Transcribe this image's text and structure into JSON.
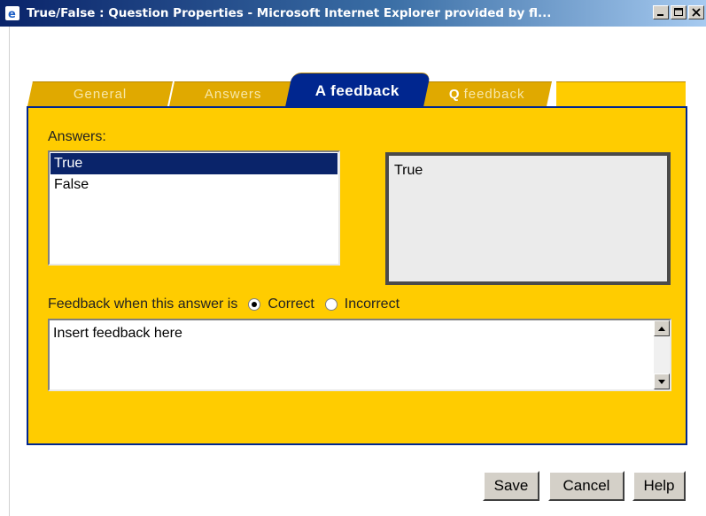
{
  "window": {
    "title": "True/False : Question Properties - Microsoft Internet Explorer provided by fl..."
  },
  "tabs": [
    {
      "label": "General",
      "active": false
    },
    {
      "label": "Answers",
      "active": false
    },
    {
      "label": "A feedback",
      "active": true
    },
    {
      "letter": "Q",
      "label": "feedback",
      "active": false
    }
  ],
  "answers": {
    "label": "Answers:",
    "items": [
      "True",
      "False"
    ],
    "selected": "True"
  },
  "preview": {
    "text": "True"
  },
  "feedback": {
    "label": "Feedback when this answer is",
    "options": [
      "Correct",
      "Incorrect"
    ],
    "selected": "Correct",
    "text": "Insert feedback here"
  },
  "buttons": {
    "save": "Save",
    "cancel": "Cancel",
    "help": "Help"
  },
  "colors": {
    "panel": "#ffcc00",
    "active_tab": "#00268f",
    "inactive_tab": "#e0a900"
  }
}
